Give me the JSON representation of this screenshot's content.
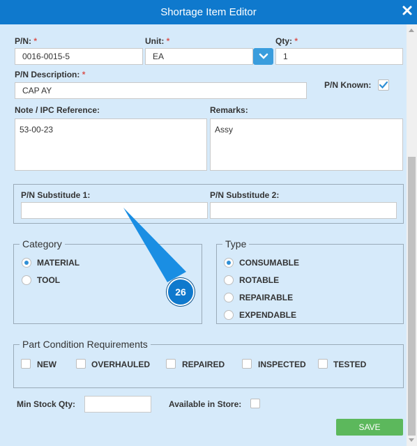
{
  "window": {
    "title": "Shortage Item Editor"
  },
  "fields": {
    "pn": {
      "label": "P/N:",
      "required": "*",
      "value": "0016-0015-5"
    },
    "unit": {
      "label": "Unit:",
      "required": "*",
      "value": "EA"
    },
    "qty": {
      "label": "Qty:",
      "required": "*",
      "value": "1"
    },
    "pn_description": {
      "label": "P/N Description:",
      "required": "*",
      "value": "CAP AY"
    },
    "pn_known": {
      "label": "P/N Known:",
      "checked": true
    },
    "note_ipc": {
      "label": "Note / IPC Reference:",
      "value": "53-00-23"
    },
    "remarks": {
      "label": "Remarks:",
      "value": "Assy"
    },
    "pn_sub1": {
      "label": "P/N Substitude 1:",
      "value": ""
    },
    "pn_sub2": {
      "label": "P/N Substitude 2:",
      "value": ""
    },
    "min_stock": {
      "label": "Min Stock Qty:",
      "value": ""
    },
    "available_store": {
      "label": "Available in Store:",
      "checked": false
    }
  },
  "category": {
    "legend": "Category",
    "options": [
      {
        "label": "MATERIAL",
        "selected": true
      },
      {
        "label": "TOOL",
        "selected": false
      }
    ]
  },
  "type": {
    "legend": "Type",
    "options": [
      {
        "label": "CONSUMABLE",
        "selected": true
      },
      {
        "label": "ROTABLE",
        "selected": false
      },
      {
        "label": "REPAIRABLE",
        "selected": false
      },
      {
        "label": "EXPENDABLE",
        "selected": false
      }
    ]
  },
  "condition": {
    "legend": "Part Condition Requirements",
    "options": [
      {
        "label": "NEW",
        "checked": false
      },
      {
        "label": "OVERHAULED",
        "checked": false
      },
      {
        "label": "REPAIRED",
        "checked": false
      },
      {
        "label": "INSPECTED",
        "checked": false
      },
      {
        "label": "TESTED",
        "checked": false
      }
    ]
  },
  "actions": {
    "save_label": "SAVE"
  },
  "annotation": {
    "badge": "26"
  },
  "colors": {
    "titlebar": "#0f79cd",
    "background": "#d6eafa",
    "accent": "#3a9ddd",
    "save": "#5cb85c",
    "required": "#d9534f"
  }
}
